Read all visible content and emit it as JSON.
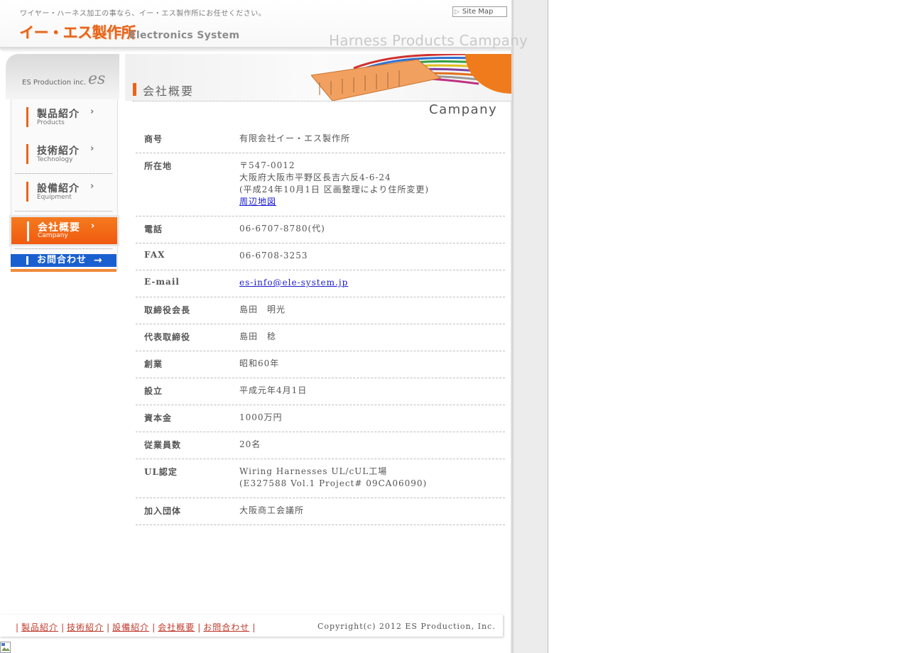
{
  "header": {
    "tagline": "ワイヤー・ハーネス加工の事なら、イー・エス製作所にお任せください。",
    "sitemap_label": "Site Map",
    "logo_jp": "イー・エス製作所",
    "logo_en": "Electronics System",
    "slogan": "Harness Products Campany"
  },
  "sidebar": {
    "brand": "ES Production inc.",
    "logo_mark": "es",
    "items": [
      {
        "label": "製品紹介",
        "sub": "Products"
      },
      {
        "label": "技術紹介",
        "sub": "Technology"
      },
      {
        "label": "設備紹介",
        "sub": "Equipment"
      },
      {
        "label": "会社概要",
        "sub": "Campany"
      }
    ],
    "contact_label": "お問合わせ",
    "accent_color": "#e8641a",
    "contact_color": "#1a5fd0"
  },
  "page": {
    "title_jp": "会社概要",
    "title_en": "Campany"
  },
  "info": {
    "name": {
      "label": "商号",
      "value": "有限会社イー・エス製作所"
    },
    "address": {
      "label": "所在地",
      "postal": "〒547-0012",
      "street": "大阪府大阪市平野区長吉六反4-6-24",
      "note": "(平成24年10月1日 区画整理により住所変更)",
      "map_link": "周辺地図"
    },
    "tel": {
      "label": "電話",
      "value": "06-6707-8780(代)"
    },
    "fax": {
      "label": "FAX",
      "value": "06-6708-3253"
    },
    "email": {
      "label": "E-mail",
      "value": "es-info@ele-system.jp"
    },
    "chairman": {
      "label": "取締役会長",
      "value": "島田　明光"
    },
    "president": {
      "label": "代表取締役",
      "value": "島田　稔"
    },
    "founded": {
      "label": "創業",
      "value": "昭和60年"
    },
    "established": {
      "label": "設立",
      "value": "平成元年4月1日"
    },
    "capital": {
      "label": "資本金",
      "value": "1000万円"
    },
    "employees": {
      "label": "従業員数",
      "value": "20名"
    },
    "ul": {
      "label": "UL認定",
      "line1": "Wiring Harnesses UL/cUL工場",
      "line2": "(E327588 Vol.1 Project# 09CA06090)"
    },
    "membership": {
      "label": "加入団体",
      "value": "大阪商工会議所"
    }
  },
  "footer": {
    "links": [
      "製品紹介",
      "技術紹介",
      "設備紹介",
      "会社概要",
      "お問合わせ"
    ],
    "copyright": "Copyright(c) 2012 ES Production, Inc."
  }
}
